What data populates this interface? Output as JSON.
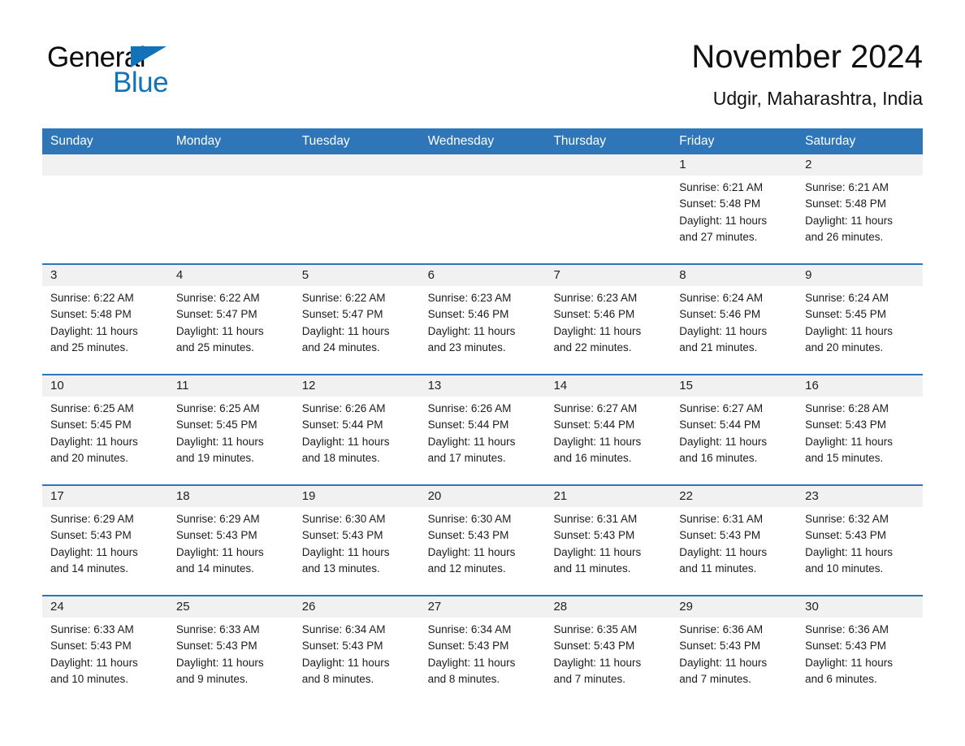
{
  "brand": {
    "name_part1": "General",
    "name_part2": "Blue",
    "flag_icon": "triangle-flag-icon",
    "accent_color": "#1273b8"
  },
  "header": {
    "title": "November 2024",
    "subtitle": "Udgir, Maharashtra, India"
  },
  "theme": {
    "header_bar_color": "#2e76b8",
    "day_number_bg": "#f1f1f1",
    "separator_color": "#2e76b8",
    "page_bg": "#ffffff",
    "text_color": "#1c1c1c"
  },
  "weekdays": [
    "Sunday",
    "Monday",
    "Tuesday",
    "Wednesday",
    "Thursday",
    "Friday",
    "Saturday"
  ],
  "weeks": [
    [
      {
        "day": "",
        "sunrise": "",
        "sunset": "",
        "daylight": "",
        "daylight_cont": "",
        "empty": true
      },
      {
        "day": "",
        "sunrise": "",
        "sunset": "",
        "daylight": "",
        "daylight_cont": "",
        "empty": true
      },
      {
        "day": "",
        "sunrise": "",
        "sunset": "",
        "daylight": "",
        "daylight_cont": "",
        "empty": true
      },
      {
        "day": "",
        "sunrise": "",
        "sunset": "",
        "daylight": "",
        "daylight_cont": "",
        "empty": true
      },
      {
        "day": "",
        "sunrise": "",
        "sunset": "",
        "daylight": "",
        "daylight_cont": "",
        "empty": true
      },
      {
        "day": "1",
        "sunrise": "Sunrise: 6:21 AM",
        "sunset": "Sunset: 5:48 PM",
        "daylight": "Daylight: 11 hours",
        "daylight_cont": "and 27 minutes.",
        "empty": false
      },
      {
        "day": "2",
        "sunrise": "Sunrise: 6:21 AM",
        "sunset": "Sunset: 5:48 PM",
        "daylight": "Daylight: 11 hours",
        "daylight_cont": "and 26 minutes.",
        "empty": false
      }
    ],
    [
      {
        "day": "3",
        "sunrise": "Sunrise: 6:22 AM",
        "sunset": "Sunset: 5:48 PM",
        "daylight": "Daylight: 11 hours",
        "daylight_cont": "and 25 minutes.",
        "empty": false
      },
      {
        "day": "4",
        "sunrise": "Sunrise: 6:22 AM",
        "sunset": "Sunset: 5:47 PM",
        "daylight": "Daylight: 11 hours",
        "daylight_cont": "and 25 minutes.",
        "empty": false
      },
      {
        "day": "5",
        "sunrise": "Sunrise: 6:22 AM",
        "sunset": "Sunset: 5:47 PM",
        "daylight": "Daylight: 11 hours",
        "daylight_cont": "and 24 minutes.",
        "empty": false
      },
      {
        "day": "6",
        "sunrise": "Sunrise: 6:23 AM",
        "sunset": "Sunset: 5:46 PM",
        "daylight": "Daylight: 11 hours",
        "daylight_cont": "and 23 minutes.",
        "empty": false
      },
      {
        "day": "7",
        "sunrise": "Sunrise: 6:23 AM",
        "sunset": "Sunset: 5:46 PM",
        "daylight": "Daylight: 11 hours",
        "daylight_cont": "and 22 minutes.",
        "empty": false
      },
      {
        "day": "8",
        "sunrise": "Sunrise: 6:24 AM",
        "sunset": "Sunset: 5:46 PM",
        "daylight": "Daylight: 11 hours",
        "daylight_cont": "and 21 minutes.",
        "empty": false
      },
      {
        "day": "9",
        "sunrise": "Sunrise: 6:24 AM",
        "sunset": "Sunset: 5:45 PM",
        "daylight": "Daylight: 11 hours",
        "daylight_cont": "and 20 minutes.",
        "empty": false
      }
    ],
    [
      {
        "day": "10",
        "sunrise": "Sunrise: 6:25 AM",
        "sunset": "Sunset: 5:45 PM",
        "daylight": "Daylight: 11 hours",
        "daylight_cont": "and 20 minutes.",
        "empty": false
      },
      {
        "day": "11",
        "sunrise": "Sunrise: 6:25 AM",
        "sunset": "Sunset: 5:45 PM",
        "daylight": "Daylight: 11 hours",
        "daylight_cont": "and 19 minutes.",
        "empty": false
      },
      {
        "day": "12",
        "sunrise": "Sunrise: 6:26 AM",
        "sunset": "Sunset: 5:44 PM",
        "daylight": "Daylight: 11 hours",
        "daylight_cont": "and 18 minutes.",
        "empty": false
      },
      {
        "day": "13",
        "sunrise": "Sunrise: 6:26 AM",
        "sunset": "Sunset: 5:44 PM",
        "daylight": "Daylight: 11 hours",
        "daylight_cont": "and 17 minutes.",
        "empty": false
      },
      {
        "day": "14",
        "sunrise": "Sunrise: 6:27 AM",
        "sunset": "Sunset: 5:44 PM",
        "daylight": "Daylight: 11 hours",
        "daylight_cont": "and 16 minutes.",
        "empty": false
      },
      {
        "day": "15",
        "sunrise": "Sunrise: 6:27 AM",
        "sunset": "Sunset: 5:44 PM",
        "daylight": "Daylight: 11 hours",
        "daylight_cont": "and 16 minutes.",
        "empty": false
      },
      {
        "day": "16",
        "sunrise": "Sunrise: 6:28 AM",
        "sunset": "Sunset: 5:43 PM",
        "daylight": "Daylight: 11 hours",
        "daylight_cont": "and 15 minutes.",
        "empty": false
      }
    ],
    [
      {
        "day": "17",
        "sunrise": "Sunrise: 6:29 AM",
        "sunset": "Sunset: 5:43 PM",
        "daylight": "Daylight: 11 hours",
        "daylight_cont": "and 14 minutes.",
        "empty": false
      },
      {
        "day": "18",
        "sunrise": "Sunrise: 6:29 AM",
        "sunset": "Sunset: 5:43 PM",
        "daylight": "Daylight: 11 hours",
        "daylight_cont": "and 14 minutes.",
        "empty": false
      },
      {
        "day": "19",
        "sunrise": "Sunrise: 6:30 AM",
        "sunset": "Sunset: 5:43 PM",
        "daylight": "Daylight: 11 hours",
        "daylight_cont": "and 13 minutes.",
        "empty": false
      },
      {
        "day": "20",
        "sunrise": "Sunrise: 6:30 AM",
        "sunset": "Sunset: 5:43 PM",
        "daylight": "Daylight: 11 hours",
        "daylight_cont": "and 12 minutes.",
        "empty": false
      },
      {
        "day": "21",
        "sunrise": "Sunrise: 6:31 AM",
        "sunset": "Sunset: 5:43 PM",
        "daylight": "Daylight: 11 hours",
        "daylight_cont": "and 11 minutes.",
        "empty": false
      },
      {
        "day": "22",
        "sunrise": "Sunrise: 6:31 AM",
        "sunset": "Sunset: 5:43 PM",
        "daylight": "Daylight: 11 hours",
        "daylight_cont": "and 11 minutes.",
        "empty": false
      },
      {
        "day": "23",
        "sunrise": "Sunrise: 6:32 AM",
        "sunset": "Sunset: 5:43 PM",
        "daylight": "Daylight: 11 hours",
        "daylight_cont": "and 10 minutes.",
        "empty": false
      }
    ],
    [
      {
        "day": "24",
        "sunrise": "Sunrise: 6:33 AM",
        "sunset": "Sunset: 5:43 PM",
        "daylight": "Daylight: 11 hours",
        "daylight_cont": "and 10 minutes.",
        "empty": false
      },
      {
        "day": "25",
        "sunrise": "Sunrise: 6:33 AM",
        "sunset": "Sunset: 5:43 PM",
        "daylight": "Daylight: 11 hours",
        "daylight_cont": "and 9 minutes.",
        "empty": false
      },
      {
        "day": "26",
        "sunrise": "Sunrise: 6:34 AM",
        "sunset": "Sunset: 5:43 PM",
        "daylight": "Daylight: 11 hours",
        "daylight_cont": "and 8 minutes.",
        "empty": false
      },
      {
        "day": "27",
        "sunrise": "Sunrise: 6:34 AM",
        "sunset": "Sunset: 5:43 PM",
        "daylight": "Daylight: 11 hours",
        "daylight_cont": "and 8 minutes.",
        "empty": false
      },
      {
        "day": "28",
        "sunrise": "Sunrise: 6:35 AM",
        "sunset": "Sunset: 5:43 PM",
        "daylight": "Daylight: 11 hours",
        "daylight_cont": "and 7 minutes.",
        "empty": false
      },
      {
        "day": "29",
        "sunrise": "Sunrise: 6:36 AM",
        "sunset": "Sunset: 5:43 PM",
        "daylight": "Daylight: 11 hours",
        "daylight_cont": "and 7 minutes.",
        "empty": false
      },
      {
        "day": "30",
        "sunrise": "Sunrise: 6:36 AM",
        "sunset": "Sunset: 5:43 PM",
        "daylight": "Daylight: 11 hours",
        "daylight_cont": "and 6 minutes.",
        "empty": false
      }
    ]
  ]
}
